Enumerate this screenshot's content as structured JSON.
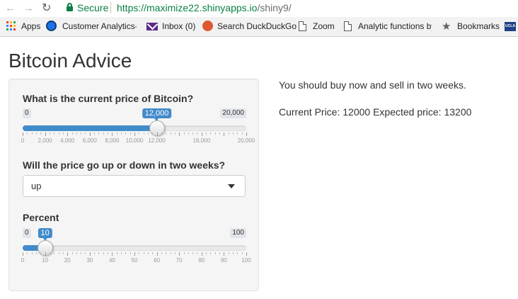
{
  "browser": {
    "back_icon": "arrow-left-icon",
    "forward_icon": "arrow-right-icon",
    "reload_icon": "reload-icon",
    "secure_label": "Secure",
    "url_base": "https://maximize22.shinyapps.io",
    "url_path": "/shiny9/",
    "bookmarks": [
      {
        "label": "Apps",
        "icon": "apps-grid-icon"
      },
      {
        "label": "Customer Analytics-M",
        "icon": "globe-icon"
      },
      {
        "label": "Inbox (0)",
        "icon": "mail-icon"
      },
      {
        "label": "Search DuckDuckGo",
        "icon": "duckduckgo-icon"
      },
      {
        "label": "Zoom",
        "icon": "document-icon"
      },
      {
        "label": "Analytic functions by",
        "icon": "document-icon"
      },
      {
        "label": "Bookmarks",
        "icon": "star-icon"
      }
    ],
    "ucla_badge": "UCLA"
  },
  "page": {
    "title": "Bitcoin Advice"
  },
  "inputs": {
    "price": {
      "label": "What is the current price of Bitcoin?",
      "min": 0,
      "max": 20000,
      "value": 12000,
      "min_label": "0",
      "max_label": "20,000",
      "value_label": "12,000",
      "tick_labels": [
        "0",
        "2,000",
        "4,000",
        "6,000",
        "8,000",
        "10,000",
        "12,000",
        "",
        "16,000",
        "",
        "20,000"
      ],
      "bar_color": "#428bca"
    },
    "direction": {
      "label": "Will the price go up or down in two weeks?",
      "selected": "up"
    },
    "percent": {
      "label": "Percent",
      "min": 0,
      "max": 100,
      "value": 10,
      "min_label": "0",
      "max_label": "100",
      "value_label": "10",
      "tick_labels": [
        "0",
        "10",
        "20",
        "30",
        "40",
        "50",
        "60",
        "70",
        "80",
        "90",
        "100"
      ],
      "bar_color": "#428bca"
    }
  },
  "outputs": {
    "advice": "You should buy now and sell in two weeks.",
    "prices": "Current Price: 12000 Expected price: 13200"
  }
}
